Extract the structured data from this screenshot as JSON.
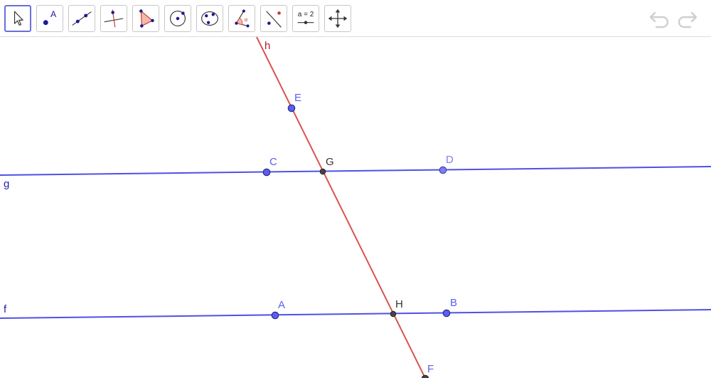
{
  "toolbar": {
    "tools": [
      {
        "name": "move-tool",
        "icon": "cursor-arrow-icon",
        "active": true
      },
      {
        "name": "point-tool",
        "icon": "point-a-icon",
        "label": "A"
      },
      {
        "name": "line-tool",
        "icon": "line-through-two-points-icon"
      },
      {
        "name": "perpendicular-line-tool",
        "icon": "perpendicular-line-icon"
      },
      {
        "name": "polygon-tool",
        "icon": "polygon-triangle-icon"
      },
      {
        "name": "circle-tool",
        "icon": "circle-center-point-icon"
      },
      {
        "name": "conic-tool",
        "icon": "ellipse-three-points-icon"
      },
      {
        "name": "angle-tool",
        "icon": "angle-icon"
      },
      {
        "name": "reflect-tool",
        "icon": "reflect-about-line-icon"
      },
      {
        "name": "slider-tool",
        "icon": "slider-icon",
        "label": "a = 2"
      },
      {
        "name": "move-graphics-view-tool",
        "icon": "move-arrows-icon"
      }
    ],
    "undo": {
      "icon": "undo-icon"
    },
    "redo": {
      "icon": "redo-icon"
    }
  },
  "colors": {
    "line_blue": "#4f50e6",
    "line_red": "#d9534f",
    "point_blue": "#5a5ef0",
    "point_dark": "#444444",
    "label_blue": "#5a5ef0",
    "label_red": "#b22222",
    "label_dark": "#333333"
  },
  "construction": {
    "lines": [
      {
        "id": "line-g",
        "label": "g",
        "color": "blue"
      },
      {
        "id": "line-f",
        "label": "f",
        "color": "blue"
      },
      {
        "id": "line-h",
        "label": "h",
        "color": "red"
      }
    ],
    "points": [
      {
        "id": "point-E",
        "label": "E"
      },
      {
        "id": "point-C",
        "label": "C"
      },
      {
        "id": "point-G",
        "label": "G"
      },
      {
        "id": "point-D",
        "label": "D"
      },
      {
        "id": "point-A",
        "label": "A"
      },
      {
        "id": "point-H",
        "label": "H"
      },
      {
        "id": "point-B",
        "label": "B"
      },
      {
        "id": "point-F",
        "label": "F"
      }
    ]
  }
}
